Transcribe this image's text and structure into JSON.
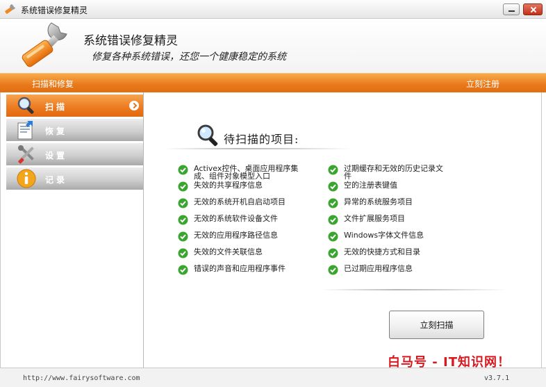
{
  "window": {
    "title": "系统错误修复精灵",
    "icon": "wrench-icon",
    "buttons": [
      "minimize-icon",
      "close-icon"
    ]
  },
  "banner": {
    "app_name": "系统错误修复精灵",
    "slogan": "修复各种系统错误，还您一个健康稳定的系统",
    "logo": "wrench-logo-icon"
  },
  "navbar": {
    "left_link": "扫描和修复",
    "right_link": "立刻注册"
  },
  "sidebar": {
    "items": [
      {
        "label": "扫描",
        "icon": "magnifier-icon",
        "active": true
      },
      {
        "label": "恢复",
        "icon": "restore-icon",
        "active": false
      },
      {
        "label": "设置",
        "icon": "tools-icon",
        "active": false
      },
      {
        "label": "记录",
        "icon": "info-icon",
        "active": false
      }
    ]
  },
  "main": {
    "heading": "待扫描的项目:",
    "heading_icon": "magnifier-icon",
    "left_items": [
      {
        "line1": "Activex控件、桌面应用程序集",
        "line2": "成、组件对象模型入口"
      },
      {
        "line1": "失效的共享程序信息"
      },
      {
        "line1": "无效的系统开机自启动项目"
      },
      {
        "line1": "无效的系统软件设备文件"
      },
      {
        "line1": "无效的应用程序路径信息"
      },
      {
        "line1": "失效的文件关联信息"
      },
      {
        "line1": "错误的声音和应用程序事件"
      }
    ],
    "right_items": [
      {
        "line1": "过期缓存和无效的历史记录文",
        "line2": "件"
      },
      {
        "line1": "空的注册表键值"
      },
      {
        "line1": "异常的系统服务项目"
      },
      {
        "line1": "文件扩展服务项目"
      },
      {
        "line1": "Windows字体文件信息"
      },
      {
        "line1": "无效的快捷方式和目录"
      },
      {
        "line1": "已过期应用程序信息"
      }
    ],
    "check_icon": "green-check-icon",
    "scan_button": "立刻扫描"
  },
  "statusbar": {
    "url": "http://www.fairysoftware.com",
    "version": "v3.7.1"
  },
  "watermark": "白马号 - IT知识网！",
  "colors": {
    "accent_orange": "#e9781a",
    "check_green": "#3aa52f",
    "watermark_red": "#d7191f"
  }
}
